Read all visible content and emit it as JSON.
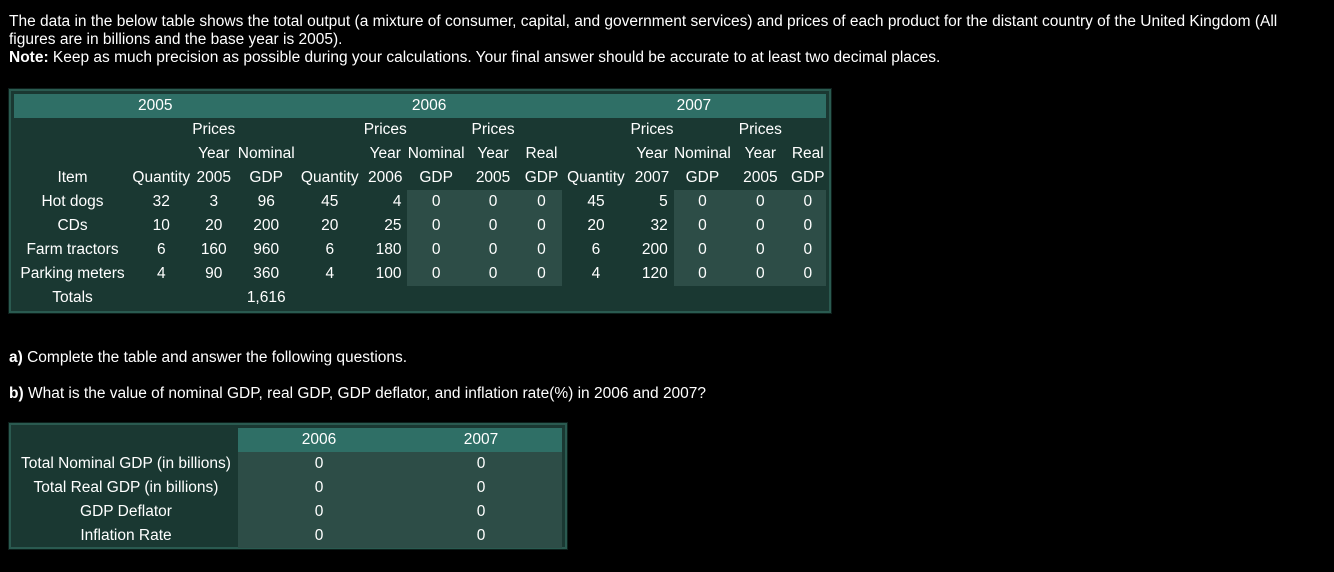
{
  "intro": {
    "line1": "The data in the below table shows the total output (a mixture of consumer, capital, and government services) and prices of each product for the distant country of the United Kingdom (All",
    "line2": "figures are in billions and the base year is 2005).",
    "note_label": "Note:",
    "note_text": " Keep as much precision as possible during your calculations. Your final answer should be accurate to at least two decimal places."
  },
  "gdp_table": {
    "years": [
      "2005",
      "2006",
      "2007"
    ],
    "header_rows": [
      [
        "",
        "",
        "Prices",
        "",
        "",
        "Prices",
        "",
        "Prices",
        "",
        "",
        "Prices",
        "",
        "Prices",
        ""
      ],
      [
        "",
        "",
        "Year",
        "Nominal",
        "",
        "Year",
        "Nominal",
        "Year",
        "Real",
        "",
        "Year",
        "Nominal",
        "Year",
        "Real"
      ],
      [
        "Item",
        "Quantity",
        "2005",
        "GDP",
        "Quantity",
        "2006",
        "GDP",
        "2005",
        "GDP",
        "Quantity",
        "2007",
        "GDP",
        "2005",
        "GDP"
      ]
    ],
    "rows": [
      {
        "item": "Hot dogs",
        "q05": "32",
        "p05": "3",
        "n05": "96",
        "q06": "45",
        "p06": "4",
        "n06": "0",
        "pb06": "0",
        "r06": "0",
        "q07": "45",
        "p07": "5",
        "n07": "0",
        "pb07": "0",
        "r07": "0"
      },
      {
        "item": "CDs",
        "q05": "10",
        "p05": "20",
        "n05": "200",
        "q06": "20",
        "p06": "25",
        "n06": "0",
        "pb06": "0",
        "r06": "0",
        "q07": "20",
        "p07": "32",
        "n07": "0",
        "pb07": "0",
        "r07": "0"
      },
      {
        "item": "Farm tractors",
        "q05": "6",
        "p05": "160",
        "n05": "960",
        "q06": "6",
        "p06": "180",
        "n06": "0",
        "pb06": "0",
        "r06": "0",
        "q07": "6",
        "p07": "200",
        "n07": "0",
        "pb07": "0",
        "r07": "0"
      },
      {
        "item": "Parking meters",
        "q05": "4",
        "p05": "90",
        "n05": "360",
        "q06": "4",
        "p06": "100",
        "n06": "0",
        "pb06": "0",
        "r06": "0",
        "q07": "4",
        "p07": "120",
        "n07": "0",
        "pb07": "0",
        "r07": "0"
      }
    ],
    "totals_label": "Totals",
    "totals_n05": "1,616"
  },
  "question_a": {
    "label": "a)",
    "text": " Complete the table and answer the following questions."
  },
  "question_b": {
    "label": "b)",
    "text": " What is the value of nominal GDP, real GDP, GDP deflator, and inflation rate(%) in 2006 and 2007?"
  },
  "summary_table": {
    "col_2006": "2006",
    "col_2007": "2007",
    "rows": [
      {
        "label": "Total Nominal GDP (in billions)",
        "v2006": "0",
        "v2007": "0"
      },
      {
        "label": "Total Real GDP (in billions)",
        "v2006": "0",
        "v2007": "0"
      },
      {
        "label": "GDP Deflator",
        "v2006": "0",
        "v2007": "0"
      },
      {
        "label": "Inflation Rate",
        "v2006": "0",
        "v2007": "0"
      }
    ]
  },
  "colors": {
    "background": "#000000",
    "panel": "#1a3832",
    "header": "#2f6f66",
    "input_cell": "#2d4d47"
  }
}
